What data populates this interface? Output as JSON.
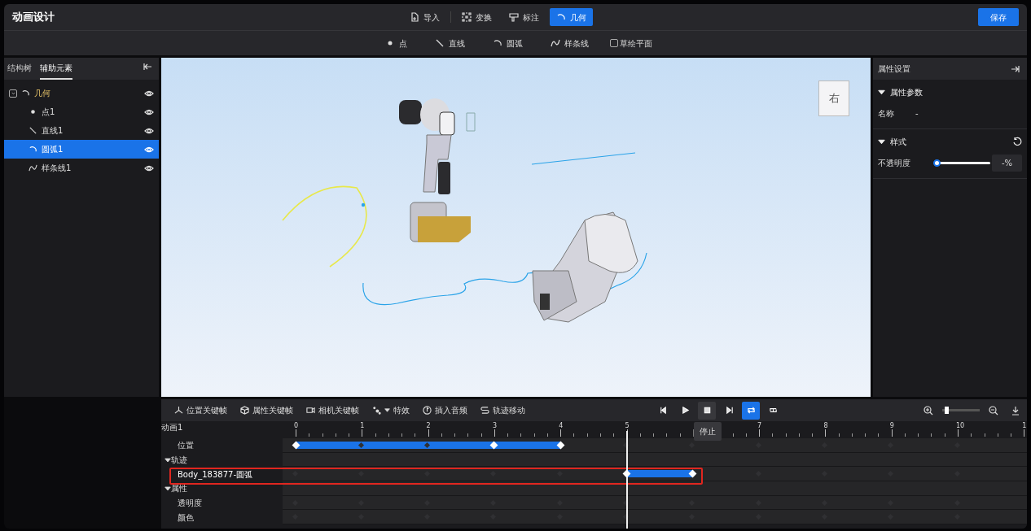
{
  "title": "动画设计",
  "tools": [
    {
      "label": "导入",
      "kind": "import",
      "selected": false
    },
    {
      "label": "变换",
      "kind": "transform",
      "selected": false
    },
    {
      "label": "标注",
      "kind": "annotate",
      "selected": false
    },
    {
      "label": "几何",
      "kind": "arc",
      "selected": true
    }
  ],
  "save_button": "保存",
  "geometry_tools": [
    {
      "label": "点",
      "kind": "point"
    },
    {
      "label": "直线",
      "kind": "line"
    },
    {
      "label": "圆弧",
      "kind": "arc"
    },
    {
      "label": "样条线",
      "kind": "spline"
    },
    {
      "label": "草绘平面",
      "kind": "checkbox",
      "checked": false
    }
  ],
  "left_panel": {
    "tabs": [
      {
        "label": "结构树",
        "selected": false
      },
      {
        "label": "辅助元素",
        "selected": true
      }
    ],
    "tree": [
      {
        "label": "几何",
        "kind": "arc",
        "expanded": true,
        "selected": false,
        "children": [
          {
            "label": "点1",
            "kind": "point",
            "selected": false
          },
          {
            "label": "直线1",
            "kind": "line",
            "selected": false
          },
          {
            "label": "圆弧1",
            "kind": "arc",
            "selected": true
          },
          {
            "label": "样条线1",
            "kind": "spline",
            "selected": false
          }
        ]
      }
    ]
  },
  "viewport": {
    "view_cube": "右"
  },
  "right_panel": {
    "title": "属性设置",
    "sections": [
      {
        "title": "属性参数",
        "expanded": true,
        "kind": "params",
        "fields": [
          {
            "label": "名称",
            "value": "-"
          }
        ]
      },
      {
        "title": "样式",
        "expanded": true,
        "kind": "style",
        "sliders": [
          {
            "label": "不透明度",
            "level": 0,
            "value": "-%"
          }
        ]
      }
    ]
  },
  "timeline": {
    "toolbar": [
      {
        "label": "位置关键帧",
        "kind": "move"
      },
      {
        "label": "属性关键帧",
        "kind": "cube"
      },
      {
        "label": "相机关键帧",
        "kind": "camera"
      },
      {
        "label": "特效",
        "kind": "effect"
      },
      {
        "label": "插入音频",
        "kind": "audio"
      },
      {
        "label": "轨迹移动",
        "kind": "path"
      }
    ],
    "playback": [
      {
        "kind": "prev",
        "selected": false
      },
      {
        "kind": "play",
        "selected": false
      },
      {
        "kind": "stop",
        "selected": false,
        "tooltip": "停止"
      },
      {
        "kind": "next",
        "selected": false
      },
      {
        "kind": "loop",
        "selected": true
      },
      {
        "kind": "once",
        "selected": false
      }
    ],
    "zoom": {
      "level": 0.1
    },
    "name": "动画1",
    "ticks": [
      {
        "label": "0",
        "covered": false,
        "playhead": false
      },
      {
        "label": "1",
        "covered": false,
        "playhead": false
      },
      {
        "label": "2",
        "covered": false,
        "playhead": false
      },
      {
        "label": "3",
        "covered": false,
        "playhead": false
      },
      {
        "label": "4",
        "covered": false,
        "playhead": false
      },
      {
        "label": "5",
        "covered": false,
        "playhead": true
      },
      {
        "covered": true,
        "playhead": false
      },
      {
        "label": "7",
        "covered": false,
        "playhead": false
      },
      {
        "label": "8",
        "covered": false,
        "playhead": false
      },
      {
        "label": "9",
        "covered": false,
        "playhead": false
      },
      {
        "label": "10",
        "covered": false,
        "playhead": false
      },
      {
        "label": "1",
        "covered": false,
        "playhead": false
      }
    ],
    "rows": [
      {
        "label": "位置",
        "kind": "track",
        "keyframes": [
          true,
          false,
          false,
          true,
          true,
          false,
          false,
          false,
          false,
          false,
          false
        ],
        "highlighted": false
      },
      {
        "label": "轨迹",
        "kind": "group",
        "expanded": true
      },
      {
        "label": "Body_183877-圆弧",
        "kind": "track",
        "keyframes": [
          false,
          false,
          false,
          false,
          false,
          true,
          true,
          false,
          false,
          false,
          false
        ],
        "highlighted": true
      },
      {
        "label": "属性",
        "kind": "group",
        "expanded": true
      },
      {
        "label": "透明度",
        "kind": "track",
        "keyframes": [
          false,
          false,
          false,
          false,
          false,
          false,
          false,
          false,
          false,
          false,
          false
        ],
        "highlighted": false
      },
      {
        "label": "颜色",
        "kind": "track",
        "keyframes": [
          false,
          false,
          false,
          false,
          false,
          false,
          false,
          false,
          false,
          false,
          false
        ],
        "highlighted": false
      }
    ]
  }
}
